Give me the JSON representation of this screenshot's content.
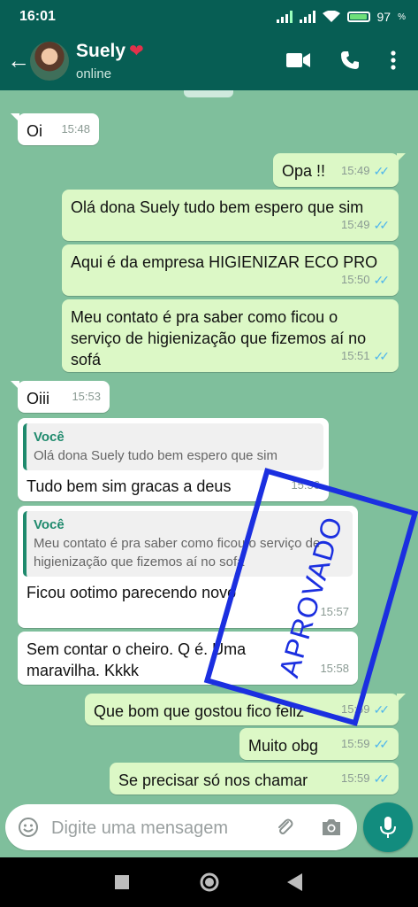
{
  "status_bar": {
    "time": "16:01",
    "battery": "97"
  },
  "header": {
    "contact_name": "Suely",
    "contact_status": "online"
  },
  "messages": [
    {
      "text": "Oi",
      "time": "15:48"
    },
    {
      "text": "Opa !!",
      "time": "15:49"
    },
    {
      "text": "Olá dona Suely tudo bem espero que sim",
      "time": "15:49"
    },
    {
      "text": "Aqui é da empresa HIGIENIZAR ECO PRO",
      "time": "15:50"
    },
    {
      "text": "Meu contato é pra  saber como ficou o serviço de higienização que fizemos aí no sofá",
      "time": "15:51"
    },
    {
      "text": "Oiii",
      "time": "15:53"
    },
    {
      "quote_author": "Você",
      "quote_text": "Olá dona Suely tudo bem espero que sim",
      "text": "Tudo bem sim gracas a  deus",
      "time": "15:56"
    },
    {
      "quote_author": "Você",
      "quote_text": "Meu contato é pra  saber como ficou o serviço de higienização que fizemos aí no sofá",
      "text": "Ficou ootimo parecendo novo",
      "time": "15:57"
    },
    {
      "text": "Sem contar o cheiro. Q é. Uma maravilha. Kkkk",
      "time": "15:58"
    },
    {
      "text": "Que bom que gostou fico feliz",
      "time": "15:59"
    },
    {
      "text": "Muito obg",
      "time": "15:59"
    },
    {
      "text": "Se precisar só nos chamar",
      "time": "15:59"
    }
  ],
  "stamp": {
    "text": "APROVADO",
    "color": "#1b2fe0"
  },
  "composer": {
    "placeholder": "Digite uma mensagem"
  },
  "colors": {
    "header": "#075e54",
    "chat_bg": "#7fbf9c",
    "outgoing_bubble": "#dcf8c6",
    "incoming_bubble": "#ffffff",
    "read_ticks": "#4fb6ec",
    "mic_button": "#128c7e"
  },
  "icons": [
    "back-arrow-icon",
    "video-call-icon",
    "phone-icon",
    "more-vert-icon",
    "emoji-icon",
    "attach-icon",
    "camera-icon",
    "mic-icon",
    "nav-recents-icon",
    "nav-home-icon",
    "nav-back-icon"
  ]
}
